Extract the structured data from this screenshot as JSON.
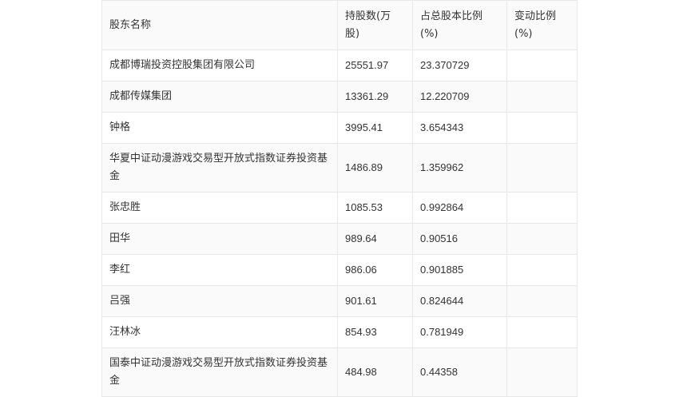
{
  "table": {
    "headers": [
      "股东名称",
      "持股数(万股)",
      "占总股本比例(%)",
      "变动比例(%)"
    ],
    "rows": [
      {
        "name": "成都博瑞投资控股集团有限公司",
        "shares": "25551.97",
        "ratio": "23.370729",
        "change": ""
      },
      {
        "name": "成都传媒集团",
        "shares": "13361.29",
        "ratio": "12.220709",
        "change": ""
      },
      {
        "name": "钟格",
        "shares": "3995.41",
        "ratio": "3.654343",
        "change": ""
      },
      {
        "name": "华夏中证动漫游戏交易型开放式指数证券投资基金",
        "shares": "1486.89",
        "ratio": "1.359962",
        "change": ""
      },
      {
        "name": "张忠胜",
        "shares": "1085.53",
        "ratio": "0.992864",
        "change": ""
      },
      {
        "name": "田华",
        "shares": "989.64",
        "ratio": "0.90516",
        "change": ""
      },
      {
        "name": "李红",
        "shares": "986.06",
        "ratio": "0.901885",
        "change": ""
      },
      {
        "name": "吕强",
        "shares": "901.61",
        "ratio": "0.824644",
        "change": ""
      },
      {
        "name": "汪林冰",
        "shares": "854.93",
        "ratio": "0.781949",
        "change": ""
      },
      {
        "name": "国泰中证动漫游戏交易型开放式指数证券投资基金",
        "shares": "484.98",
        "ratio": "0.44358",
        "change": ""
      }
    ]
  }
}
